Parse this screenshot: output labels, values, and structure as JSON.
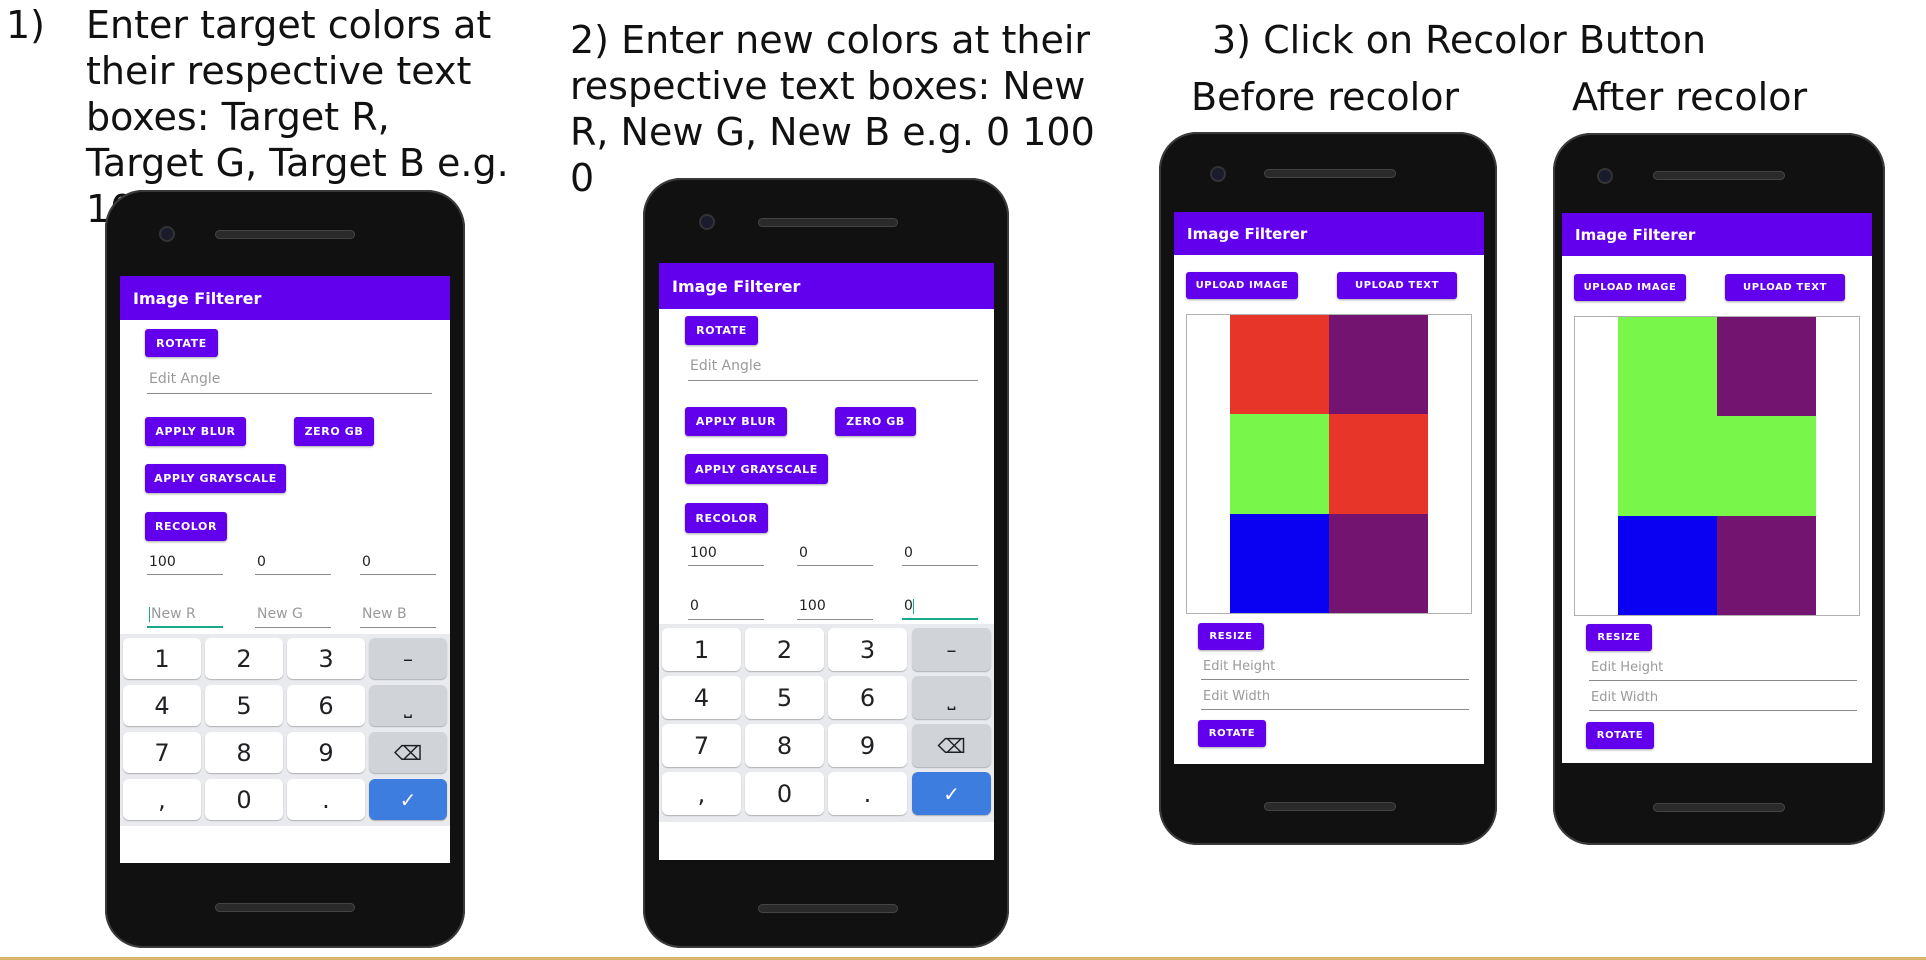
{
  "captions": {
    "step1_number": "1)",
    "step1_text": "Enter target colors at their respective text boxes: Target R, Target G, Target B e.g. 100 0 0",
    "step2_text": "2) Enter new colors at their respective text boxes: New R, New G, New B e.g. 0 100 0",
    "step3_text": "3) Click on Recolor Button",
    "before_label": "Before recolor",
    "after_label": "After recolor"
  },
  "app": {
    "title": "Image Filterer",
    "rotate_label": "ROTATE",
    "edit_angle_placeholder": "Edit Angle",
    "apply_blur_label": "APPLY BLUR",
    "zero_gb_label": "ZERO GB",
    "apply_grayscale_label": "APPLY GRAYSCALE",
    "recolor_label": "RECOLOR",
    "new_r_placeholder": "New R",
    "new_g_placeholder": "New G",
    "new_b_placeholder": "New B",
    "upload_image_label": "UPLOAD IMAGE",
    "upload_text_label": "UPLOAD TEXT",
    "resize_label": "RESIZE",
    "edit_height_placeholder": "Edit Height",
    "edit_width_placeholder": "Edit Width"
  },
  "phone1": {
    "target_r": "100",
    "target_g": "0",
    "target_b": "0"
  },
  "phone2": {
    "target_r": "100",
    "target_g": "0",
    "target_b": "0",
    "new_r": "0",
    "new_g": "100",
    "new_b": "0"
  },
  "keyboard": {
    "k1": "1",
    "k2": "2",
    "k3": "3",
    "minus": "–",
    "k4": "4",
    "k5": "5",
    "k6": "6",
    "space": "⎵",
    "k7": "7",
    "k8": "8",
    "k9": "9",
    "backspace": "⌫",
    "comma": ",",
    "k0": "0",
    "dot": ".",
    "done": "✓"
  },
  "colors": {
    "accent": "#6200ee",
    "red": "#e8352a",
    "purple": "#741471",
    "green": "#78f64a",
    "blue": "#0a00f2"
  },
  "before_grid": [
    [
      "red",
      "purple"
    ],
    [
      "green",
      "red"
    ],
    [
      "blue",
      "purple"
    ]
  ],
  "after_grid": [
    [
      "green",
      "purple"
    ],
    [
      "green",
      "green"
    ],
    [
      "blue",
      "purple"
    ]
  ]
}
